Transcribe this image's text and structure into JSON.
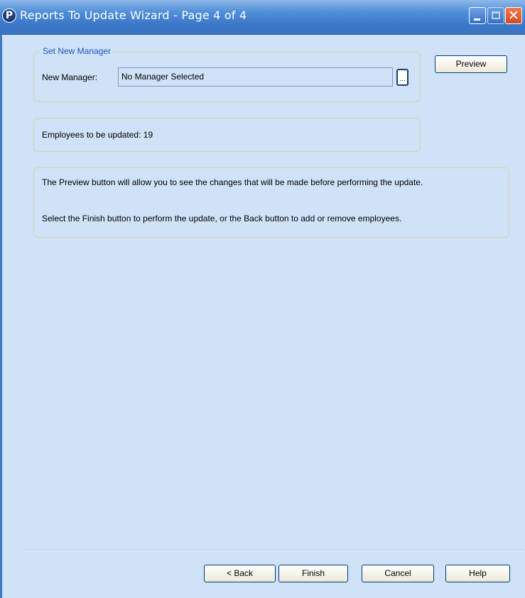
{
  "window": {
    "title": "Reports To Update Wizard - Page 4 of 4",
    "logo_glyph": "P"
  },
  "titlebar_buttons": {
    "close_glyph": "✕"
  },
  "set_manager": {
    "legend": "Set New Manager",
    "label": "New Manager:",
    "value": "No Manager Selected",
    "browse_label": "..."
  },
  "preview_button": "Preview",
  "employees": {
    "text": "Employees to be updated: 19"
  },
  "instructions": {
    "line1": "The Preview button will allow you to see the changes that will be made before performing the update.",
    "line2": "Select the Finish button to perform the update, or the Back button to add or remove employees."
  },
  "footer": {
    "back": "< Back",
    "finish": "Finish",
    "cancel": "Cancel",
    "help": "Help"
  }
}
